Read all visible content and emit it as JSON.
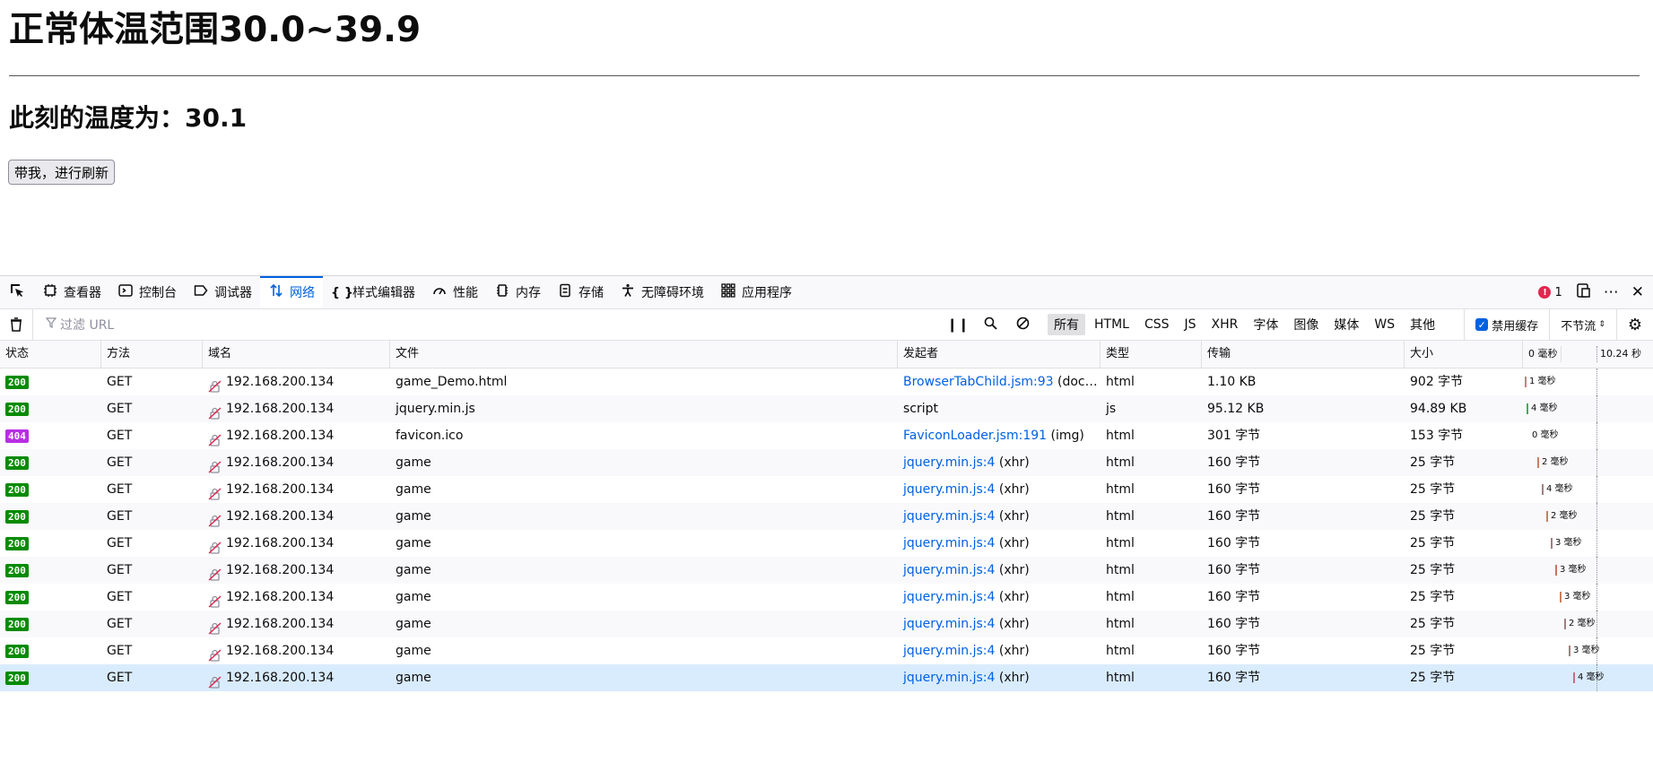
{
  "page": {
    "heading": "正常体温范围30.0~39.9",
    "current_temp": "此刻的温度为：30.1",
    "refresh_button": "带我，进行刷新"
  },
  "toolbox": {
    "tabs": [
      {
        "label": "查看器",
        "icon": "inspector-icon"
      },
      {
        "label": "控制台",
        "icon": "console-icon"
      },
      {
        "label": "调试器",
        "icon": "debugger-icon"
      },
      {
        "label": "网络",
        "icon": "network-icon",
        "active": true
      },
      {
        "label": "样式编辑器",
        "icon": "style-editor-icon"
      },
      {
        "label": "性能",
        "icon": "performance-icon"
      },
      {
        "label": "内存",
        "icon": "memory-icon"
      },
      {
        "label": "存储",
        "icon": "storage-icon"
      },
      {
        "label": "无障碍环境",
        "icon": "accessibility-icon"
      },
      {
        "label": "应用程序",
        "icon": "application-icon"
      }
    ],
    "error_count": "1"
  },
  "filterbar": {
    "filter_placeholder": "过滤 URL",
    "types": [
      "所有",
      "HTML",
      "CSS",
      "JS",
      "XHR",
      "字体",
      "图像",
      "媒体",
      "WS",
      "其他"
    ],
    "active_type": "所有",
    "disable_cache": "禁用缓存",
    "disable_cache_checked": true,
    "throttle": "不节流"
  },
  "columns": {
    "status": "状态",
    "method": "方法",
    "domain": "域名",
    "file": "文件",
    "initiator": "发起者",
    "type": "类型",
    "transferred": "传输",
    "size": "大小",
    "waterfall_start": "0 毫秒",
    "waterfall_end": "10.24 秒"
  },
  "colors": {
    "status_200": "#058b00",
    "status_404": "#b82ee5",
    "accent": "#0061e0",
    "selected_row": "#d9ecfd"
  },
  "requests": [
    {
      "status": "200",
      "method": "GET",
      "domain": "192.168.200.134",
      "file": "game_Demo.html",
      "initiator_link": "BrowserTabChild.jsm:93",
      "initiator_extra": " (docu…",
      "type": "html",
      "transferred": "1.10 KB",
      "size": "902 字节",
      "timing": "1 毫秒",
      "wf_start": 0,
      "bar_color": "#c88080"
    },
    {
      "status": "200",
      "method": "GET",
      "domain": "192.168.200.134",
      "file": "jquery.min.js",
      "initiator_link": "",
      "initiator_extra": "script",
      "type": "js",
      "transferred": "95.12 KB",
      "size": "94.89 KB",
      "timing": "4 毫秒",
      "wf_start": 2,
      "bar_color": "#3fae5a"
    },
    {
      "status": "404",
      "method": "GET",
      "domain": "192.168.200.134",
      "file": "favicon.ico",
      "initiator_link": "FaviconLoader.jsm:191",
      "initiator_extra": " (img)",
      "type": "html",
      "transferred": "301 字节",
      "size": "153 字节",
      "timing": "0 毫秒",
      "wf_start": 3,
      "bar_color": ""
    },
    {
      "status": "200",
      "method": "GET",
      "domain": "192.168.200.134",
      "file": "game",
      "initiator_link": "jquery.min.js:4",
      "initiator_extra": " (xhr)",
      "type": "html",
      "transferred": "160 字节",
      "size": "25 字节",
      "timing": "2 毫秒",
      "wf_start": 14,
      "bar_color": "#c88060"
    },
    {
      "status": "200",
      "method": "GET",
      "domain": "192.168.200.134",
      "file": "game",
      "initiator_link": "jquery.min.js:4",
      "initiator_extra": " (xhr)",
      "type": "html",
      "transferred": "160 字节",
      "size": "25 字节",
      "timing": "4 毫秒",
      "wf_start": 19,
      "bar_color": "#a08080"
    },
    {
      "status": "200",
      "method": "GET",
      "domain": "192.168.200.134",
      "file": "game",
      "initiator_link": "jquery.min.js:4",
      "initiator_extra": " (xhr)",
      "type": "html",
      "transferred": "160 字节",
      "size": "25 字节",
      "timing": "2 毫秒",
      "wf_start": 24,
      "bar_color": "#c88060"
    },
    {
      "status": "200",
      "method": "GET",
      "domain": "192.168.200.134",
      "file": "game",
      "initiator_link": "jquery.min.js:4",
      "initiator_extra": " (xhr)",
      "type": "html",
      "transferred": "160 字节",
      "size": "25 字节",
      "timing": "3 毫秒",
      "wf_start": 29,
      "bar_color": "#a08080"
    },
    {
      "status": "200",
      "method": "GET",
      "domain": "192.168.200.134",
      "file": "game",
      "initiator_link": "jquery.min.js:4",
      "initiator_extra": " (xhr)",
      "type": "html",
      "transferred": "160 字节",
      "size": "25 字节",
      "timing": "3 毫秒",
      "wf_start": 34,
      "bar_color": "#d07060"
    },
    {
      "status": "200",
      "method": "GET",
      "domain": "192.168.200.134",
      "file": "game",
      "initiator_link": "jquery.min.js:4",
      "initiator_extra": " (xhr)",
      "type": "html",
      "transferred": "160 字节",
      "size": "25 字节",
      "timing": "3 毫秒",
      "wf_start": 39,
      "bar_color": "#c88060"
    },
    {
      "status": "200",
      "method": "GET",
      "domain": "192.168.200.134",
      "file": "game",
      "initiator_link": "jquery.min.js:4",
      "initiator_extra": " (xhr)",
      "type": "html",
      "transferred": "160 字节",
      "size": "25 字节",
      "timing": "2 毫秒",
      "wf_start": 44,
      "bar_color": "#a08080"
    },
    {
      "status": "200",
      "method": "GET",
      "domain": "192.168.200.134",
      "file": "game",
      "initiator_link": "jquery.min.js:4",
      "initiator_extra": " (xhr)",
      "type": "html",
      "transferred": "160 字节",
      "size": "25 字节",
      "timing": "3 毫秒",
      "wf_start": 49,
      "bar_color": "#a08080"
    },
    {
      "status": "200",
      "method": "GET",
      "domain": "192.168.200.134",
      "file": "game",
      "initiator_link": "jquery.min.js:4",
      "initiator_extra": " (xhr)",
      "type": "html",
      "transferred": "160 字节",
      "size": "25 字节",
      "timing": "4 毫秒",
      "wf_start": 54,
      "bar_color": "#c07080",
      "selected": true
    }
  ]
}
